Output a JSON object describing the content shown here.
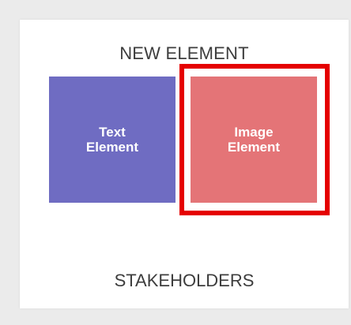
{
  "panel": {
    "title": "NEW ELEMENT",
    "tiles": [
      {
        "label": "Text\nElement",
        "color": "#6f6cc2"
      },
      {
        "label": "Image\nElement",
        "color": "#e47477"
      }
    ],
    "highlight_color": "#e50000",
    "section_label": "STAKEHOLDERS"
  }
}
